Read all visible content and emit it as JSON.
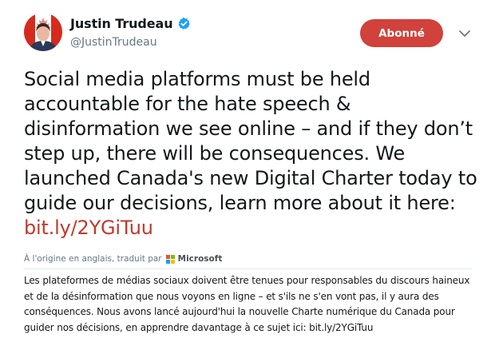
{
  "author": {
    "display_name": "Justin Trudeau",
    "handle": "@JustinTrudeau",
    "verified": true
  },
  "follow_button": {
    "label": "Abonné",
    "color": "#d0423b"
  },
  "tweet": {
    "text": "Social media platforms must be held accountable for the hate speech & disinformation we see online – and if they don’t step up, there will be consequences. We launched Canada's new Digital Charter today to guide our decisions, learn more about it here: ",
    "link": "bit.ly/2YGiTuu",
    "link_color": "#c0392b"
  },
  "translation": {
    "credit": "À l'origine en anglais, traduit par",
    "provider": "Microsoft",
    "text": "Les plateformes de médias sociaux doivent être tenues pour responsables du discours haineux et de la désinformation que nous voyons en ligne – et s'ils ne s'en vont pas, il y aura des conséquences. Nous avons lancé aujourd'hui la nouvelle Charte numérique du Canada pour guider nos décisions, en apprendre davantage à ce sujet ici: bit.ly/2YGiTuu"
  },
  "icons": {
    "avatar": "profile-photo-icon",
    "verified": "verified-badge-icon",
    "caret": "chevron-down-icon",
    "provider_logo": "microsoft-logo-icon"
  }
}
